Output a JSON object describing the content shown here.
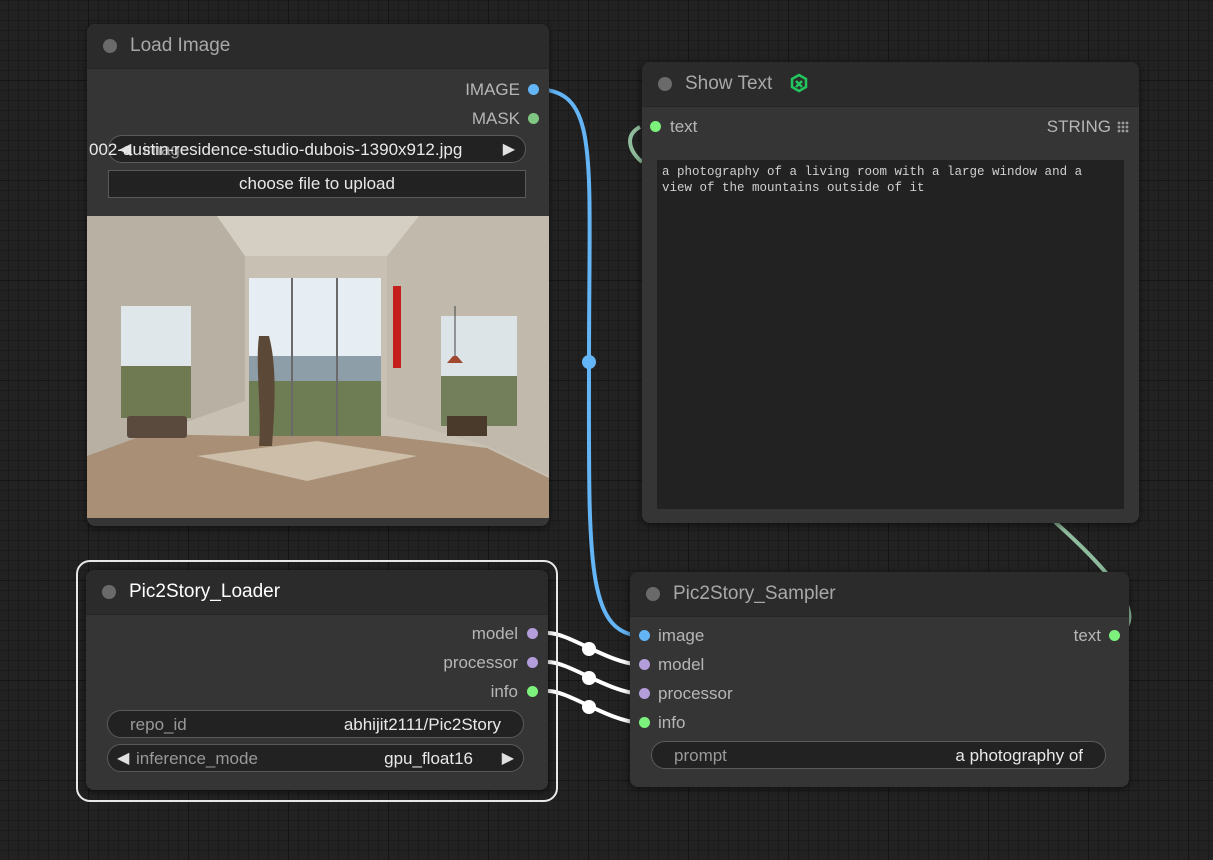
{
  "load_image": {
    "title": "Load Image",
    "outputs": [
      "IMAGE",
      "MASK"
    ],
    "image_widget": {
      "overlap_prefix": "002-",
      "name": "image",
      "value": "austin-residence-studio-dubois-1390x912.jpg"
    },
    "upload_button": "choose file to upload",
    "preview_alt": "Interior photo: living room with a large window and mountain view"
  },
  "show_text": {
    "title": "Show Text",
    "input_label": "text",
    "output_label": "STRING",
    "content": "a photography of a living room with a large window and a view of the mountains outside of it",
    "badge_icon": "custom-scripts-icon",
    "badge_color": "#22c55e"
  },
  "loader": {
    "title": "Pic2Story_Loader",
    "outputs": [
      "model",
      "processor",
      "info"
    ],
    "repo_id": {
      "name": "repo_id",
      "value": "abhijit2111/Pic2Story"
    },
    "inference_mode": {
      "name": "inference_mode",
      "value": "gpu_float16"
    }
  },
  "sampler": {
    "title": "Pic2Story_Sampler",
    "inputs": [
      "image",
      "model",
      "processor",
      "info"
    ],
    "output_label": "text",
    "prompt": {
      "name": "prompt",
      "value": "a photography of"
    }
  },
  "colors": {
    "image_link": "#64b5f6",
    "text_link": "#8fbc9c",
    "loader_link": "#ffffff",
    "green_slot": "#7cf27c",
    "purple_slot": "#b39ddb"
  }
}
